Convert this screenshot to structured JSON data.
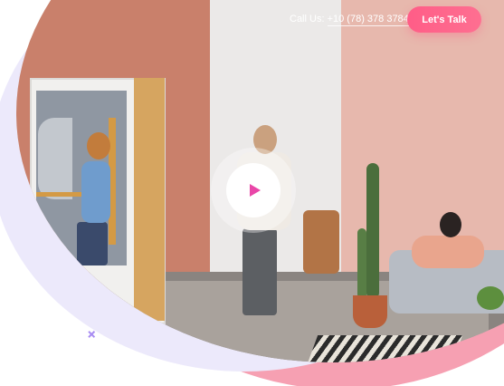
{
  "header": {
    "call_label": "Call Us:",
    "phone": "+10 (78) 378 3784",
    "cta_label": "Let's Talk"
  },
  "hero": {
    "video_play": "play-icon"
  },
  "colors": {
    "accent": "#ff5d87",
    "play_icon": "#e946a8",
    "swoosh": "#f6a0b2",
    "ring": "#ece9fb",
    "decor_x": "#a88cf2"
  },
  "decor": {
    "x_icon": "×"
  }
}
